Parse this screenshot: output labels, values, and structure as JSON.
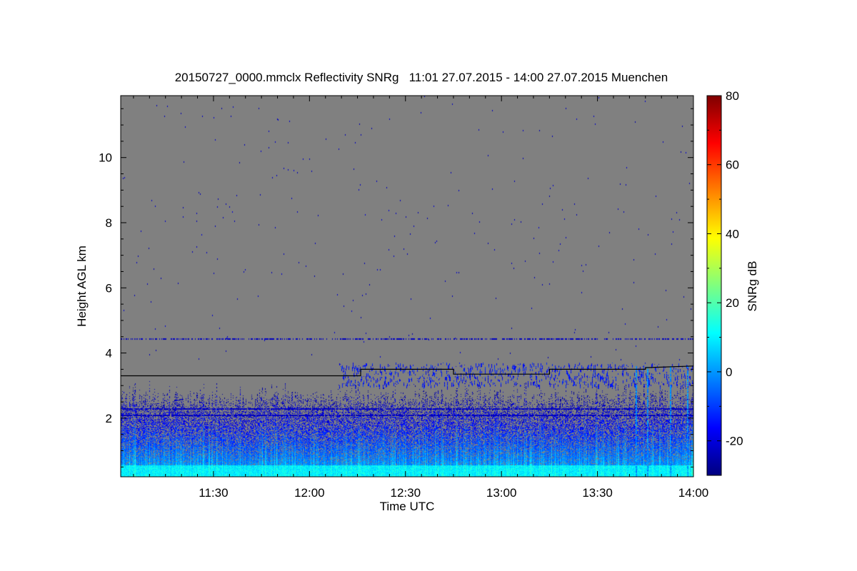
{
  "colors": {
    "background": "#ffffff",
    "no_signal": "#808080",
    "cloud_top_line": "#000000",
    "colormap": [
      "#00007f",
      "#0000ff",
      "#007fff",
      "#00ffff",
      "#7fff7f",
      "#ffff00",
      "#ff7f00",
      "#ff0000",
      "#7f0000"
    ]
  },
  "chart_data": {
    "type": "heatmap",
    "title": "20150727_0000.mmclx Reflectivity SNRg   11:01 27.07.2015 - 14:00 27.07.2015 Muenchen",
    "xlabel": "Time UTC",
    "ylabel": "Height AGL km",
    "x_range": [
      "11:01",
      "14:00"
    ],
    "x_ticks": [
      "11:30",
      "12:00",
      "12:30",
      "13:00",
      "13:30",
      "14:00"
    ],
    "y_range_km": [
      0.2,
      11.9
    ],
    "y_ticks": [
      2,
      4,
      6,
      8,
      10
    ],
    "colorbar": {
      "label": "SNRg dB",
      "range": [
        -30,
        80
      ],
      "ticks": [
        -20,
        0,
        20,
        40,
        60,
        80
      ],
      "colormap": "jet"
    },
    "background_value": "no signal (grey)",
    "features": {
      "boundary_layer_echo_top_km": 2.5,
      "interference_bands_km": [
        4.45,
        2.3,
        2.1
      ],
      "upper_cloud_patches_km": [
        3.0,
        3.7
      ]
    },
    "cloud_top_line": {
      "times": [
        "11:01",
        "12:16",
        "12:16",
        "12:45",
        "12:45",
        "13:15",
        "13:15",
        "13:45",
        "13:45",
        "14:00"
      ],
      "heights_km": [
        3.3,
        3.3,
        3.5,
        3.5,
        3.35,
        3.35,
        3.5,
        3.5,
        3.55,
        3.6
      ]
    }
  }
}
